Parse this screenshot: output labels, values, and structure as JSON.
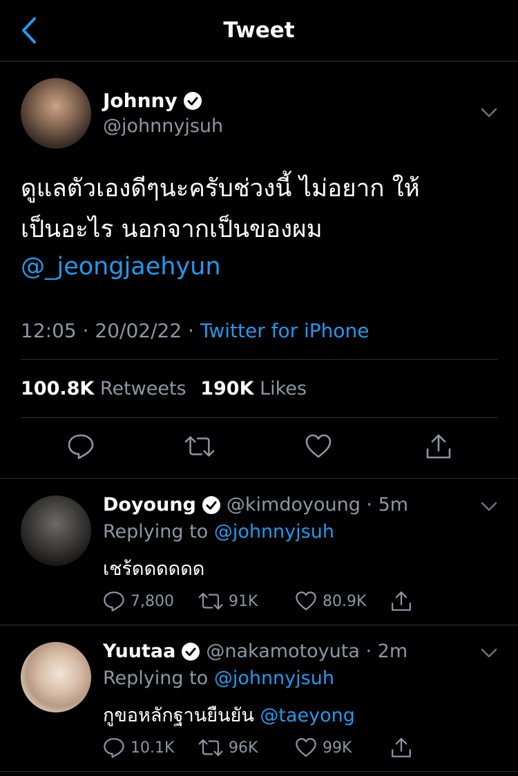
{
  "header": {
    "title": "Tweet",
    "back_icon": "chevron-left-icon"
  },
  "tweet": {
    "name": "Johnny",
    "handle": "@johnnyjsuh",
    "text_line1": "ดูแลตัวเองดีๆนะครับช่วงนี้ ไม่อยาก ให้",
    "text_line2": "เป็นอะไร นอกจากเป็นของผม",
    "mention": "@_jeongjaehyun",
    "time": "12:05 · 20/02/22 · ",
    "source": "Twitter for iPhone",
    "retweets": "100.8K",
    "retweets_label": "Retweets",
    "likes": "190K",
    "likes_label": "Likes"
  },
  "replies": [
    {
      "name": "Doyoung",
      "handle": "@kimdoyoung · 5m",
      "replying_prefix": "Replying to ",
      "replying_to": "@johnnyjsuh",
      "text": "เชร้ดดดดดด",
      "mention": "",
      "replies": "7,800",
      "retweets": "91K",
      "likes": "80.9K"
    },
    {
      "name": "Yuutaa",
      "handle": "@nakamotoyuta · 2m",
      "replying_prefix": "Replying to ",
      "replying_to": "@johnnyjsuh",
      "text": "กูขอหลักฐานยืนยัน ",
      "mention": "@taeyong",
      "replies": "10.1K",
      "retweets": "96K",
      "likes": "99K"
    }
  ],
  "colors": {
    "accent": "#1d9bf0",
    "muted": "#8b98a5",
    "background": "#000000",
    "divider": "#2f3336"
  }
}
